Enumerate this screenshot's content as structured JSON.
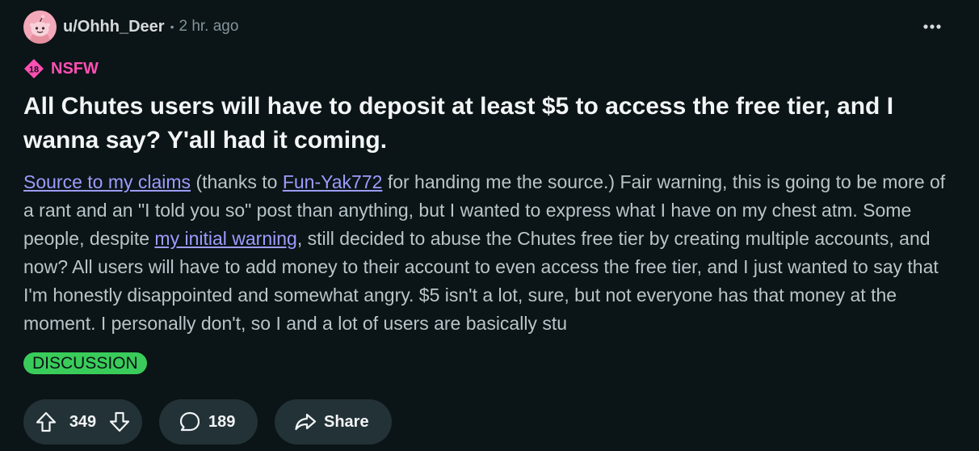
{
  "post": {
    "username": "u/Ohhh_Deer",
    "separator": "•",
    "time": "2 hr. ago",
    "nsfw": {
      "badge": "18",
      "label": "NSFW"
    },
    "title": "All Chutes users will have to deposit at least $5 to access the free tier, and I wanna say? Y'all had it coming.",
    "body": {
      "link_source": "Source to my claims",
      "text_1": " (thanks to ",
      "link_user": "Fun-Yak772",
      "text_2": " for handing me the source.) Fair warning, this is going to be more of a rant and an \"I told you so\" post than anything, but I wanted to express what I have on my chest atm. Some people, despite ",
      "link_warning": "my initial warning",
      "text_3": ", still decided to abuse the Chutes free tier by creating multiple accounts, and now? All users will have to add money to their account to even access the free tier, and I just wanted to say that I'm honestly disappointed and somewhat angry. $5 isn't a lot, sure, but not everyone has that money at the moment. I personally don't, so I and a lot of users are basically stu"
    },
    "flair": "DISCUSSION",
    "actions": {
      "votes": "349",
      "comments": "189",
      "share_label": "Share"
    }
  },
  "icons": {
    "avatar": "avatar-snoo-icon",
    "more": "ellipsis-icon",
    "nsfw": "nsfw-18-icon",
    "upvote": "upvote-arrow-icon",
    "downvote": "downvote-arrow-icon",
    "comment": "comment-bubble-icon",
    "share": "share-arrow-icon"
  },
  "colors": {
    "background": "#0b1416",
    "nsfw": "#ff4fb4",
    "link": "#9c9cff",
    "flair": "#3acc5a",
    "pill": "#223237"
  }
}
